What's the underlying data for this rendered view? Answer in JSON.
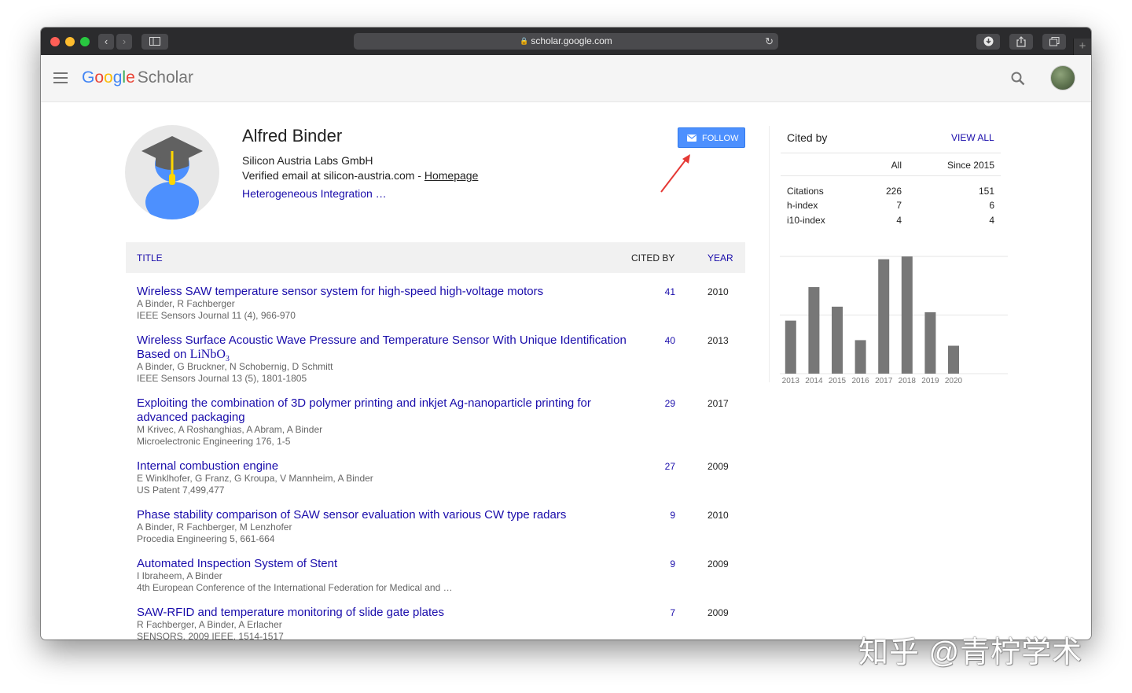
{
  "browser": {
    "url": "scholar.google.com"
  },
  "header": {
    "logo_google": [
      "G",
      "o",
      "o",
      "g",
      "l",
      "e"
    ],
    "logo_colors": [
      "#4285f4",
      "#ea4335",
      "#fbbc05",
      "#4285f4",
      "#34a853",
      "#ea4335"
    ],
    "logo_scholar": "Scholar"
  },
  "profile": {
    "name": "Alfred Binder",
    "affiliation": "Silicon Austria Labs GmbH",
    "email_text": "Verified email at silicon-austria.com - ",
    "homepage_label": "Homepage",
    "interests": "Heterogeneous Integration …",
    "follow_label": "FOLLOW"
  },
  "table": {
    "headers": {
      "title": "TITLE",
      "cited_by": "CITED BY",
      "year": "YEAR"
    },
    "rows": [
      {
        "title": "Wireless SAW temperature sensor system for high-speed high-voltage motors",
        "authors": "A Binder, R Fachberger",
        "venue": "IEEE Sensors Journal 11 (4), 966-970",
        "cited": "41",
        "year": "2010"
      },
      {
        "title": "Wireless Surface Acoustic Wave Pressure and Temperature Sensor With Unique Identification Based on",
        "title_math": "LiNbO",
        "title_math_sub": "3",
        "authors": "A Binder, G Bruckner, N Schobernig, D Schmitt",
        "venue": "IEEE Sensors Journal 13 (5), 1801-1805",
        "cited": "40",
        "year": "2013"
      },
      {
        "title": "Exploiting the combination of 3D polymer printing and inkjet Ag-nanoparticle printing for advanced packaging",
        "authors": "M Krivec, A Roshanghias, A Abram, A Binder",
        "venue": "Microelectronic Engineering 176, 1-5",
        "cited": "29",
        "year": "2017"
      },
      {
        "title": "Internal combustion engine",
        "authors": "E Winklhofer, G Franz, G Kroupa, V Mannheim, A Binder",
        "venue": "US Patent 7,499,477",
        "cited": "27",
        "year": "2009"
      },
      {
        "title": "Phase stability comparison of SAW sensor evaluation with various CW type radars",
        "authors": "A Binder, R Fachberger, M Lenzhofer",
        "venue": "Procedia Engineering 5, 661-664",
        "cited": "9",
        "year": "2010"
      },
      {
        "title": "Automated Inspection System of Stent",
        "authors": "I Ibraheem, A Binder",
        "venue": "4th European Conference of the International Federation for Medical and …",
        "cited": "9",
        "year": "2009"
      },
      {
        "title": "SAW-RFID and temperature monitoring of slide gate plates",
        "authors": "R Fachberger, A Binder, A Erlacher",
        "venue": "SENSORS, 2009 IEEE, 1514-1517",
        "cited": "7",
        "year": "2009"
      }
    ]
  },
  "cited_by": {
    "title": "Cited by",
    "view_all": "VIEW ALL",
    "col_all": "All",
    "col_since": "Since 2015",
    "rows": [
      {
        "label": "Citations",
        "all": "226",
        "since": "151"
      },
      {
        "label": "h-index",
        "all": "7",
        "since": "6"
      },
      {
        "label": "i10-index",
        "all": "4",
        "since": "4"
      }
    ]
  },
  "chart_data": {
    "type": "bar",
    "categories": [
      "2013",
      "2014",
      "2015",
      "2016",
      "2017",
      "2018",
      "2019",
      "2020"
    ],
    "values": [
      19,
      31,
      24,
      12,
      41,
      42,
      22,
      10
    ],
    "yticks": [
      0,
      21,
      42
    ],
    "ylim": [
      0,
      42
    ],
    "bar_color": "#777777"
  },
  "watermark": "知乎 @青柠学术"
}
